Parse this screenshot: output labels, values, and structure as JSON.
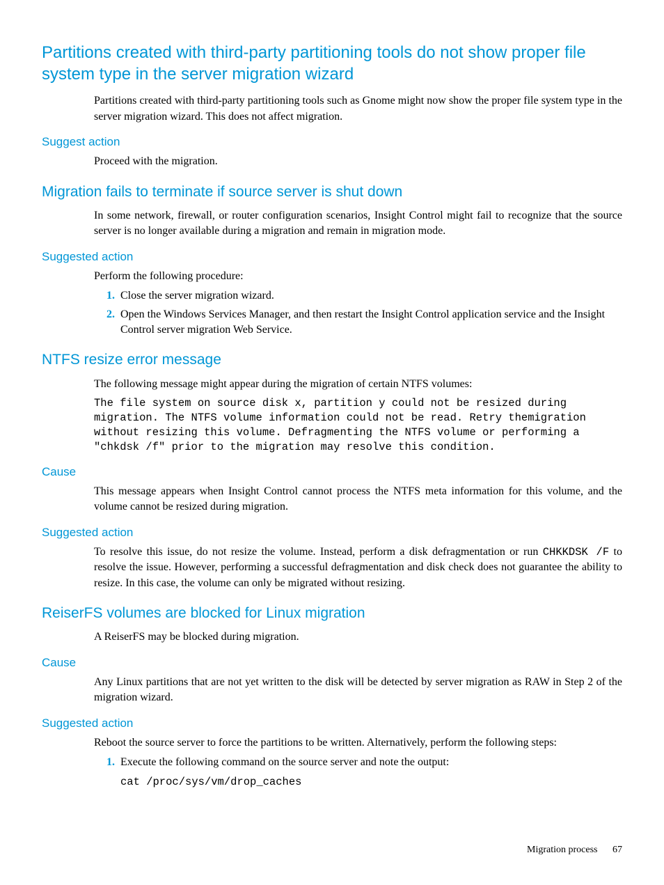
{
  "sec1": {
    "title": "Partitions created with third-party partitioning tools do not show proper file system type in the server migration wizard",
    "p1": "Partitions created with third-party partitioning tools such as Gnome might now show the proper file system type in the server migration wizard. This does not affect migration.",
    "h_suggest": "Suggest action",
    "p_suggest": "Proceed with the migration."
  },
  "sec2": {
    "title": "Migration fails to terminate if source server is shut down",
    "p1": "In some network, firewall, or router configuration scenarios, Insight Control might fail to recognize that the source server is no longer available during a migration and remain in migration mode.",
    "h_suggest": "Suggested action",
    "p_suggest": "Perform the following procedure:",
    "li1": "Close the server migration wizard.",
    "li2": "Open the Windows Services Manager, and then restart the Insight Control application service and the Insight Control server migration Web Service."
  },
  "sec3": {
    "title": "NTFS resize error message",
    "p1": "The following message might appear during the migration of certain NTFS volumes:",
    "code": "The file system on source disk x, partition y could not be resized during migration. The NTFS volume information could not be read. Retry themigration without resizing this volume. Defragmenting the NTFS volume or performing a \"chkdsk /f\" prior to the migration may resolve this condition.",
    "h_cause": "Cause",
    "p_cause": "This message appears when Insight Control cannot process the NTFS meta information for this volume, and the volume cannot be resized during migration.",
    "h_suggest": "Suggested action",
    "p_suggest_pre": "To resolve this issue, do not resize the volume. Instead, perform a disk defragmentation or run ",
    "p_suggest_code": "CHKKDSK /F",
    "p_suggest_post": " to resolve the issue. However, performing a successful defragmentation and disk check does not guarantee the ability to resize. In this case, the volume can only be migrated without resizing."
  },
  "sec4": {
    "title": "ReiserFS volumes are blocked for Linux migration",
    "p1": "A ReiserFS may be blocked during migration.",
    "h_cause": "Cause",
    "p_cause": "Any Linux partitions that are not yet written to the disk will be detected by server migration as RAW in Step 2 of the migration wizard.",
    "h_suggest": "Suggested action",
    "p_suggest": "Reboot the source server to force the partitions to be written. Alternatively, perform the following steps:",
    "li1": "Execute the following command on the source server and note the output:",
    "code1": "cat /proc/sys/vm/drop_caches"
  },
  "footer": {
    "label": "Migration process",
    "page": "67"
  }
}
